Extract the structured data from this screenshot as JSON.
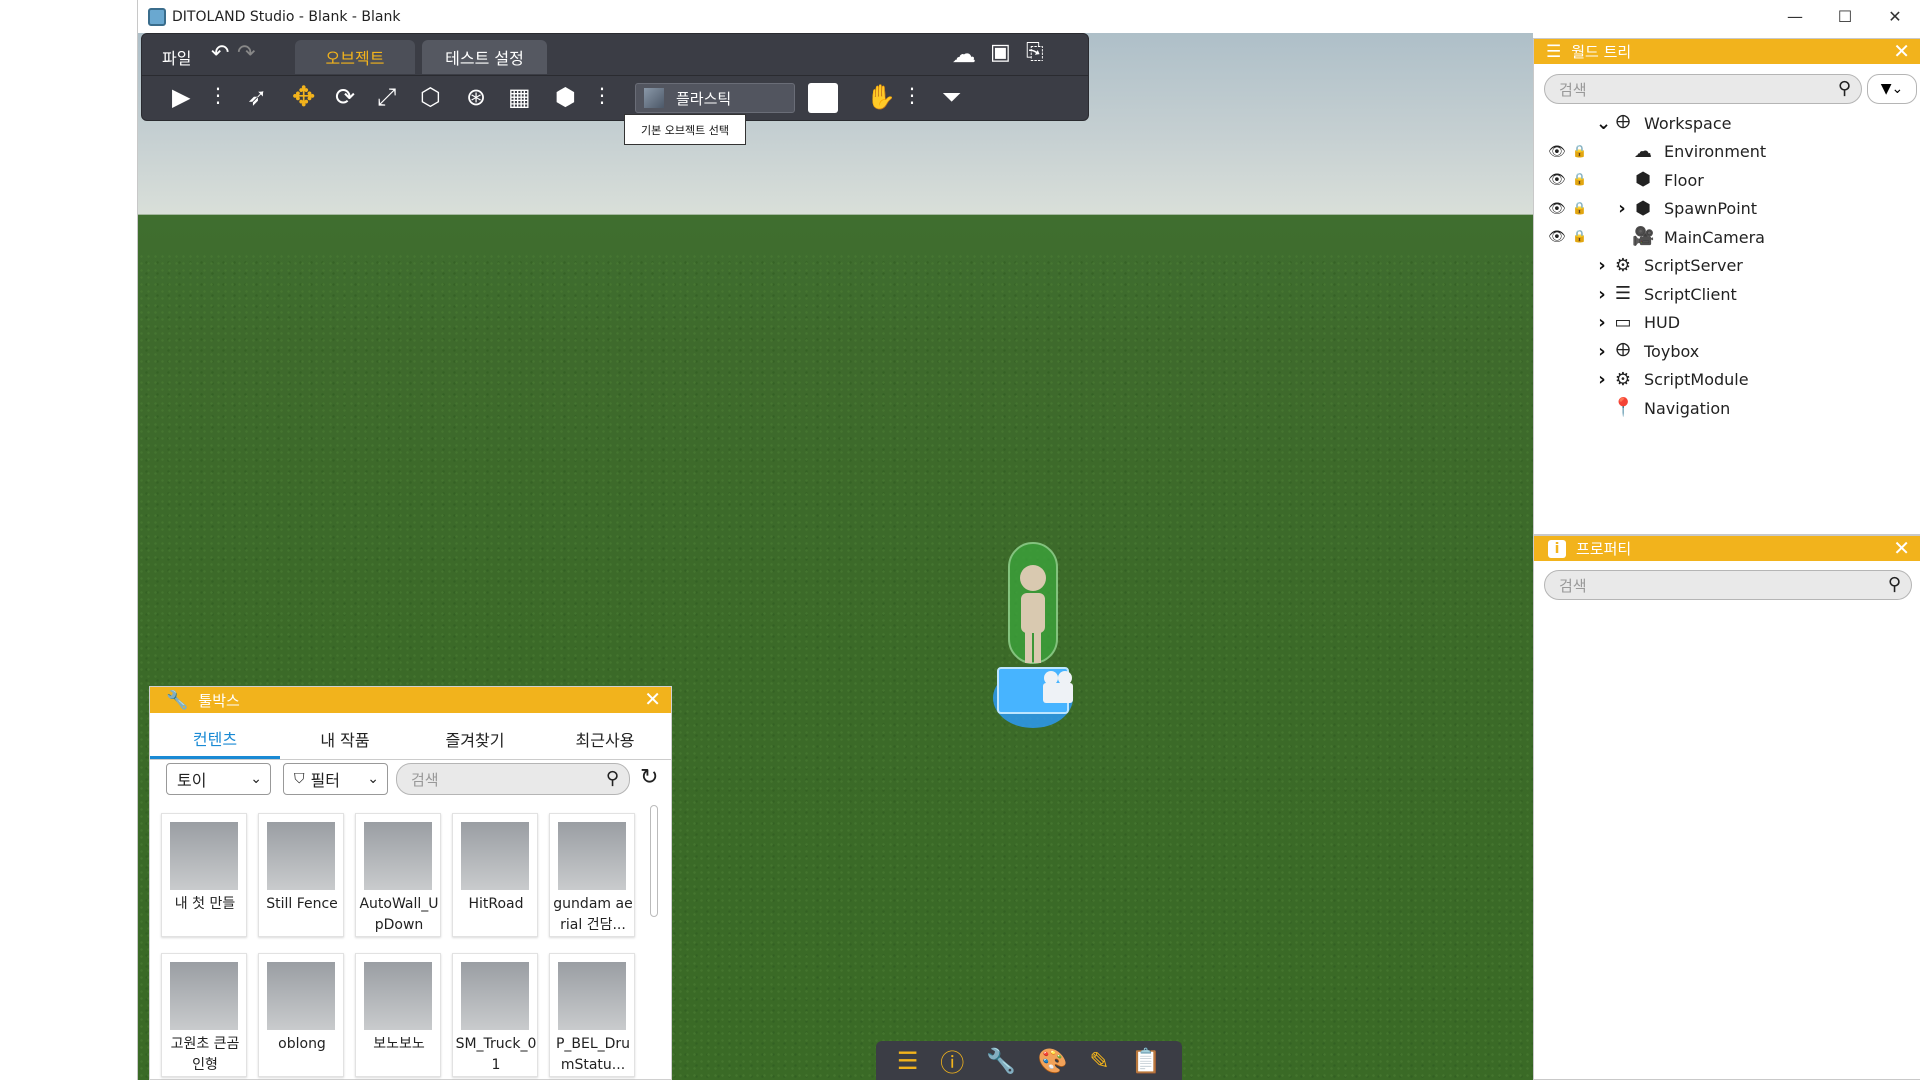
{
  "window": {
    "title": "DITOLAND Studio - Blank - Blank",
    "minimize": "—",
    "maximize": "☐",
    "close": "✕"
  },
  "toolbar": {
    "file_menu": "파일",
    "tabs": [
      {
        "label": "오브젝트",
        "active": true
      },
      {
        "label": "테스트 설정",
        "active": false
      }
    ],
    "material_label": "플라스틱",
    "tooltip": "기본 오브젝트 선택",
    "icons": [
      "play-icon",
      "more-icon",
      "select-icon",
      "move-icon",
      "rotate-icon",
      "scale-icon",
      "transform-icon",
      "physics-icon",
      "grid-icon",
      "part-icon",
      "more-icon",
      "color-swatch",
      "anchor-icon",
      "more-icon",
      "visibility-filter-icon"
    ]
  },
  "world_tree": {
    "title": "월드 트리",
    "search_placeholder": "검색",
    "items": [
      {
        "label": "Workspace",
        "icon": "workspace-icon",
        "expand": "v",
        "level": 0,
        "eye": false,
        "lock": "none"
      },
      {
        "label": "Environment",
        "icon": "environment-icon",
        "expand": "",
        "level": 1,
        "eye": true,
        "lock": "unlocked"
      },
      {
        "label": "Floor",
        "icon": "cube-icon",
        "expand": "",
        "level": 1,
        "eye": true,
        "lock": "locked"
      },
      {
        "label": "SpawnPoint",
        "icon": "cube-icon",
        "expand": ">",
        "level": 1,
        "eye": true,
        "lock": "unlocked"
      },
      {
        "label": "MainCamera",
        "icon": "camera-icon",
        "expand": "",
        "level": 1,
        "eye": true,
        "lock": "unlocked"
      },
      {
        "label": "ScriptServer",
        "icon": "script-server-icon",
        "expand": ">",
        "level": 0,
        "eye": false,
        "lock": "none"
      },
      {
        "label": "ScriptClient",
        "icon": "script-client-icon",
        "expand": ">",
        "level": 0,
        "eye": false,
        "lock": "none"
      },
      {
        "label": "HUD",
        "icon": "hud-icon",
        "expand": ">",
        "level": 0,
        "eye": false,
        "lock": "none"
      },
      {
        "label": "Toybox",
        "icon": "toybox-icon",
        "expand": ">",
        "level": 0,
        "eye": false,
        "lock": "none"
      },
      {
        "label": "ScriptModule",
        "icon": "script-module-icon",
        "expand": ">",
        "level": 0,
        "eye": false,
        "lock": "none"
      },
      {
        "label": "Navigation",
        "icon": "navigation-icon",
        "expand": "",
        "level": 0,
        "eye": false,
        "lock": "none"
      }
    ]
  },
  "properties": {
    "title": "프로퍼티",
    "search_placeholder": "검색"
  },
  "toolbox": {
    "title": "툴박스",
    "tabs": [
      {
        "label": "컨텐츠",
        "active": true
      },
      {
        "label": "내 작품",
        "active": false
      },
      {
        "label": "즐겨찾기",
        "active": false
      },
      {
        "label": "최근사용",
        "active": false
      }
    ],
    "category": "토이",
    "filter": "필터",
    "search_placeholder": "검색",
    "items": [
      {
        "name": "내 첫 만들"
      },
      {
        "name": "Still Fence"
      },
      {
        "name": "AutoWall_UpDown"
      },
      {
        "name": "HitRoad"
      },
      {
        "name": "gundam aerial 건담..."
      },
      {
        "name": "고원초 큰곰 인형"
      },
      {
        "name": "oblong"
      },
      {
        "name": "보노보노"
      },
      {
        "name": "SM_Truck_01"
      },
      {
        "name": "P_BEL_DrumStatu..."
      }
    ]
  },
  "dock": {
    "icons": [
      "world-tree-icon",
      "info-icon",
      "toolbox-icon",
      "palette-icon",
      "edit-icon",
      "notes-icon"
    ]
  },
  "colors": {
    "accent": "#f2b31c",
    "toolbar_bg": "#3b3d45",
    "active_tab_bg": "#4c4f58",
    "selected_tab_text": "#f2b31c"
  }
}
